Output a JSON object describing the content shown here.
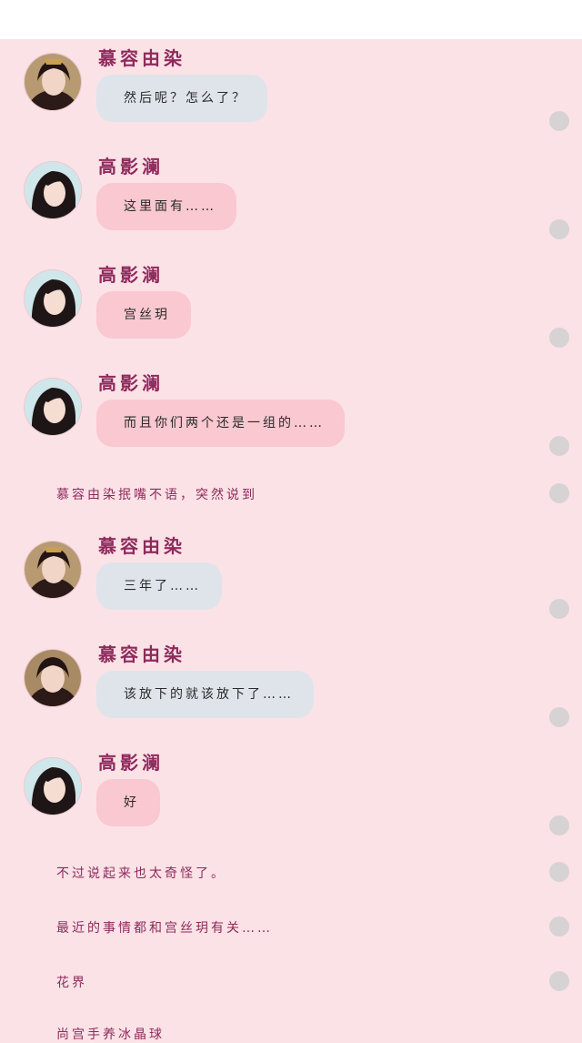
{
  "characters": {
    "murong": {
      "name": "慕容由染"
    },
    "gao": {
      "name": "高影澜"
    }
  },
  "messages": [
    {
      "type": "chat",
      "speaker": "murong",
      "name": "慕容由染",
      "text": "然后呢？怎么了？",
      "style": "blue"
    },
    {
      "type": "chat",
      "speaker": "gao",
      "name": "高影澜",
      "text": "这里面有……",
      "style": "pink"
    },
    {
      "type": "chat",
      "speaker": "gao",
      "name": "高影澜",
      "text": "宫丝玥",
      "style": "pink"
    },
    {
      "type": "chat",
      "speaker": "gao",
      "name": "高影澜",
      "text": "而且你们两个还是一组的……",
      "style": "pink"
    },
    {
      "type": "narration",
      "text": "慕容由染抿嘴不语，突然说到"
    },
    {
      "type": "chat",
      "speaker": "murong",
      "name": "慕容由染",
      "text": "三年了……",
      "style": "blue"
    },
    {
      "type": "chat",
      "speaker": "murong",
      "name": "慕容由染",
      "text": "该放下的就该放下了……",
      "style": "blue"
    },
    {
      "type": "chat",
      "speaker": "gao",
      "name": "高影澜",
      "text": "好",
      "style": "pink"
    },
    {
      "type": "narration",
      "text": "不过说起来也太奇怪了。"
    },
    {
      "type": "narration",
      "text": "最近的事情都和宫丝玥有关……"
    },
    {
      "type": "narration",
      "text": "花界"
    },
    {
      "type": "narration",
      "text": "尚宫手养冰晶球"
    }
  ],
  "icons": {
    "dot": "more-dot-icon"
  },
  "colors": {
    "background": "#fbe2e6",
    "name": "#8e2a5c",
    "bubble_blue": "#dfe4ea",
    "bubble_pink": "#f9c8d0"
  }
}
